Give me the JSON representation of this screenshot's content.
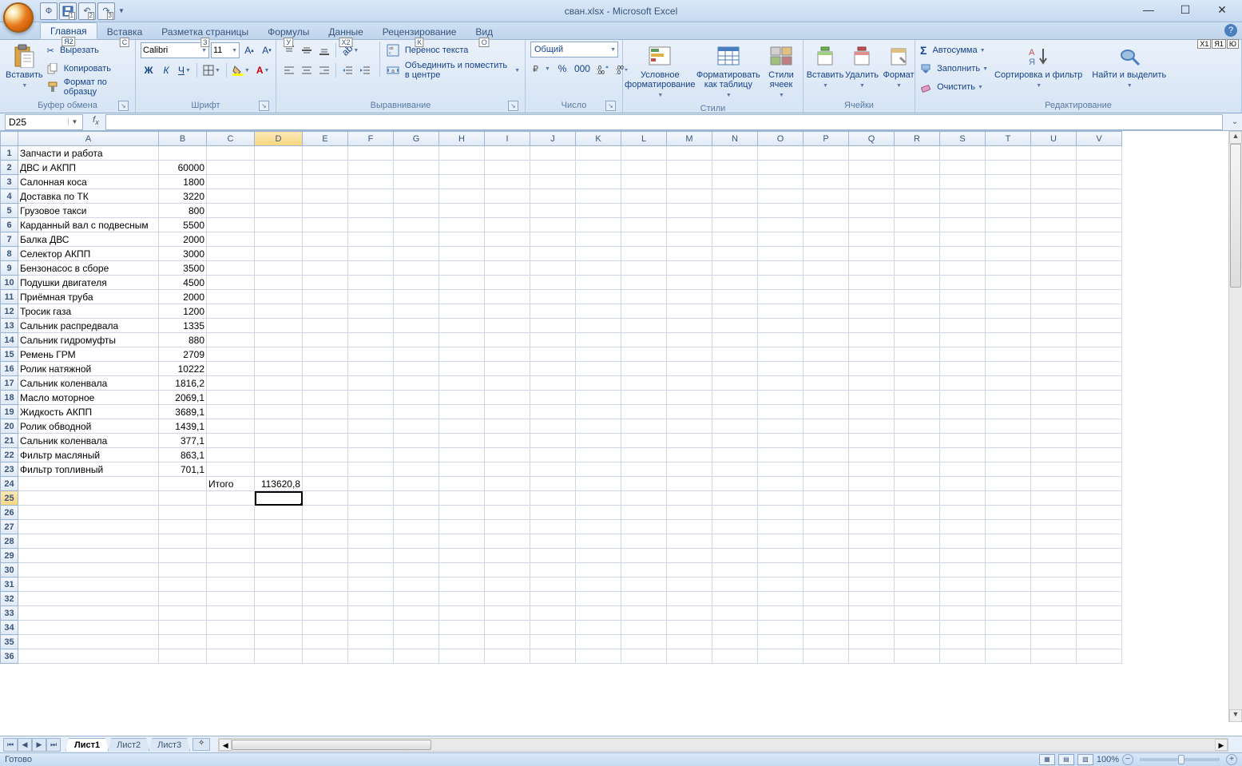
{
  "title": "cван.xlsx - Microsoft Excel",
  "qat_keys": [
    "1",
    "2",
    "3"
  ],
  "office_key": "Ф",
  "tabs": {
    "items": [
      "Главная",
      "Вставка",
      "Разметка страницы",
      "Формулы",
      "Данные",
      "Рецензирование",
      "Вид"
    ],
    "keys": [
      "Я2",
      "С",
      "З",
      "У",
      "Х2",
      "К",
      "О"
    ],
    "active": 0
  },
  "help_keys": [
    "Х1",
    "Я1",
    "Ю"
  ],
  "clipboard": {
    "paste": "Вставить",
    "cut": "Вырезать",
    "copy": "Копировать",
    "format_painter": "Формат по образцу",
    "group": "Буфер обмена"
  },
  "font": {
    "name": "Calibri",
    "size": "11",
    "group": "Шрифт"
  },
  "alignment": {
    "wrap": "Перенос текста",
    "merge": "Объединить и поместить в центре",
    "group": "Выравнивание"
  },
  "number": {
    "format": "Общий",
    "group": "Число"
  },
  "styles": {
    "conditional": "Условное форматирование",
    "as_table": "Форматировать как таблицу",
    "cell_styles": "Стили ячеек",
    "group": "Стили"
  },
  "cells": {
    "insert": "Вставить",
    "delete": "Удалить",
    "format": "Формат",
    "group": "Ячейки"
  },
  "editing": {
    "autosum": "Автосумма",
    "fill": "Заполнить",
    "clear": "Очистить",
    "sort": "Сортировка и фильтр",
    "find": "Найти и выделить",
    "group": "Редактирование"
  },
  "namebox": "D25",
  "formula": "",
  "columns": [
    "A",
    "B",
    "C",
    "D",
    "E",
    "F",
    "G",
    "H",
    "I",
    "J",
    "K",
    "L",
    "M",
    "N",
    "O",
    "P",
    "Q",
    "R",
    "S",
    "T",
    "U",
    "V"
  ],
  "col_widths": {
    "A": 176,
    "B": 60,
    "C": 60,
    "D": 60,
    "default": 57
  },
  "selected_cell": {
    "row": 25,
    "col": "D"
  },
  "rows": [
    {
      "n": 1,
      "A": "Запчасти и работа"
    },
    {
      "n": 2,
      "A": "ДВС и АКПП",
      "B": "60000"
    },
    {
      "n": 3,
      "A": "Салонная коса",
      "B": "1800"
    },
    {
      "n": 4,
      "A": "Доставка по ТК",
      "B": "3220"
    },
    {
      "n": 5,
      "A": "Грузовое такси",
      "B": "800"
    },
    {
      "n": 6,
      "A": "Карданный вал с подвесным",
      "B": "5500"
    },
    {
      "n": 7,
      "A": "Балка ДВС",
      "B": "2000"
    },
    {
      "n": 8,
      "A": "Селектор АКПП",
      "B": "3000"
    },
    {
      "n": 9,
      "A": "Бензонасос в сборе",
      "B": "3500"
    },
    {
      "n": 10,
      "A": "Подушки двигателя",
      "B": "4500"
    },
    {
      "n": 11,
      "A": "Приёмная труба",
      "B": "2000"
    },
    {
      "n": 12,
      "A": "Тросик газа",
      "B": "1200"
    },
    {
      "n": 13,
      "A": "Сальник распредвала",
      "B": "1335"
    },
    {
      "n": 14,
      "A": "Сальник гидромуфты",
      "B": "880"
    },
    {
      "n": 15,
      "A": "Ремень ГРМ",
      "B": "2709"
    },
    {
      "n": 16,
      "A": "Ролик натяжной",
      "B": "10222"
    },
    {
      "n": 17,
      "A": "Сальник коленвала",
      "B": "1816,2"
    },
    {
      "n": 18,
      "A": "Масло моторное",
      "B": "2069,1"
    },
    {
      "n": 19,
      "A": "Жидкость АКПП",
      "B": "3689,1"
    },
    {
      "n": 20,
      "A": "Ролик обводной",
      "B": "1439,1"
    },
    {
      "n": 21,
      "A": "Сальник коленвала",
      "B": "377,1"
    },
    {
      "n": 22,
      "A": "Фильтр масляный",
      "B": "863,1"
    },
    {
      "n": 23,
      "A": "Фильтр топливный",
      "B": "701,1"
    },
    {
      "n": 24,
      "C": "Итого",
      "D": "113620,8"
    },
    {
      "n": 25
    },
    {
      "n": 26
    },
    {
      "n": 27
    },
    {
      "n": 28
    },
    {
      "n": 29
    },
    {
      "n": 30
    },
    {
      "n": 31
    },
    {
      "n": 32
    },
    {
      "n": 33
    },
    {
      "n": 34
    },
    {
      "n": 35
    },
    {
      "n": 36
    }
  ],
  "sheets": {
    "items": [
      "Лист1",
      "Лист2",
      "Лист3"
    ],
    "active": 0
  },
  "status": "Готово",
  "zoom": "100%"
}
